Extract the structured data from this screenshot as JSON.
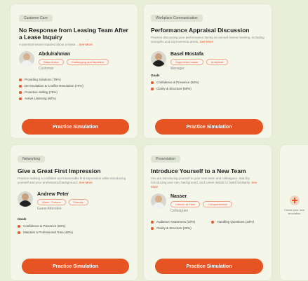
{
  "practice_label": "Practice Simulation",
  "cards": [
    {
      "tag": "Customer Care",
      "title": "No Response from Leasing Team After a Lease Inquiry",
      "description": "A potential tenant inquired about a lease...",
      "more": "See More",
      "person_name": "Abdulrahman",
      "pills": [
        "Stays Active",
        "Challenging and Impatient"
      ],
      "role": "Customer",
      "goals_heading": "",
      "goals": [
        "Providing Solutions (75%)",
        "De-escalation & Conflict Resolution (70%)",
        "Proactive Selling (75%)",
        "Active Listening (60%)"
      ]
    },
    {
      "tag": "Workplace Communication",
      "title": "Performance Appraisal Discussion",
      "description": "Practice discussing your performance during an annual review meeting, including strengths and improvement areas.",
      "more": "See More",
      "person_name": "Basel Mostafa",
      "pills": [
        "Supportive Leader",
        "Analytical"
      ],
      "role": "Manager",
      "goals_heading": "Goals",
      "goals": [
        "Confidence & Presence (50%)",
        "Clarity & Structure (50%)"
      ]
    },
    {
      "tag": "Networking",
      "title": "Give a Great First Impression",
      "description": "Practice making a confident and memorable first impression while introducing yourself and your professional background.",
      "more": "See More",
      "person_name": "Andrew Peter",
      "pills": [
        "Warm, Curious",
        "Friendly"
      ],
      "role": "Guest Attendee",
      "goals_heading": "Goals",
      "goals": [
        "Confidence & Presence (50%)",
        "Maintain a Professional Tone (50%)"
      ]
    },
    {
      "tag": "Presentation",
      "title": "Introduce Yourself to a New Team",
      "description": "You are introducing yourself to your new team and colleagues. Start by introducing your role, background, and career details to build familiarity.",
      "more": "See More",
      "person_name": "Nasser",
      "pills": [
        "Casual, at Ease",
        "Comprehensive"
      ],
      "role": "Colleagues",
      "goals_heading": "",
      "goals": [
        "Audience Awareness (33%)",
        "Handling Questions (33%)",
        "Clarity & Structure (33%)"
      ]
    }
  ],
  "create_card": {
    "label": "Create your own simulation"
  },
  "colors": {
    "accent": "#e65424",
    "card_bg": "#f4f6ea",
    "page_bg": "#e8eed8"
  }
}
